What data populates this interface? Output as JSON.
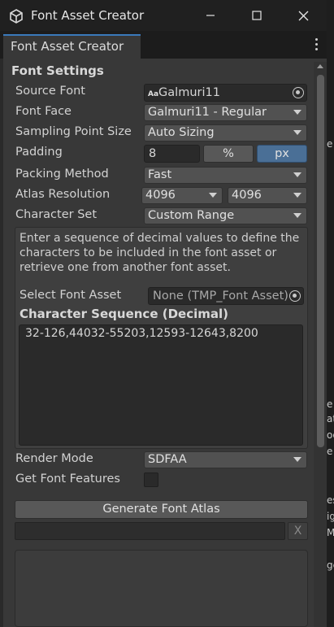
{
  "window": {
    "title": "Font Asset Creator",
    "icon": "unity-cube-icon"
  },
  "tab": {
    "label": "Font Asset Creator"
  },
  "section": {
    "title": "Font Settings"
  },
  "fields": {
    "source_font": {
      "label": "Source Font",
      "value": "Galmuri11",
      "icon_text": "Aa"
    },
    "font_face": {
      "label": "Font Face",
      "value": "Galmuri11 - Regular"
    },
    "sampling_point_size": {
      "label": "Sampling Point Size",
      "value": "Auto Sizing"
    },
    "padding": {
      "label": "Padding",
      "value": "8",
      "percent_label": "%",
      "px_label": "px",
      "unit_selected": "px"
    },
    "packing_method": {
      "label": "Packing Method",
      "value": "Fast"
    },
    "atlas_resolution": {
      "label": "Atlas Resolution",
      "width": "4096",
      "height": "4096"
    },
    "character_set": {
      "label": "Character Set",
      "value": "Custom Range"
    }
  },
  "custom_range": {
    "help_text": "Enter a sequence of decimal values to define the characters to be included in the font asset or retrieve one from another font asset.",
    "select_font_asset_label": "Select Font Asset",
    "select_font_asset_value": "None (TMP_Font Asset)",
    "char_sequence_title": "Character Sequence (Decimal)",
    "char_sequence_value": "32-126,44032-55203,12593-12643,8200"
  },
  "render_mode": {
    "label": "Render Mode",
    "value": "SDFAA"
  },
  "get_font_features": {
    "label": "Get Font Features",
    "checked": false
  },
  "generate_button": {
    "label": "Generate Font Atlas"
  },
  "clear_button": {
    "label": "X"
  },
  "peek_text": [
    "e",
    "at",
    "oe",
    "e",
    "es",
    "ig",
    "Mo",
    "ge"
  ],
  "colors": {
    "accent": "#3a79bb",
    "selected_unit": "#4a6f96",
    "panel": "#383838",
    "title_bar": "#202020"
  }
}
